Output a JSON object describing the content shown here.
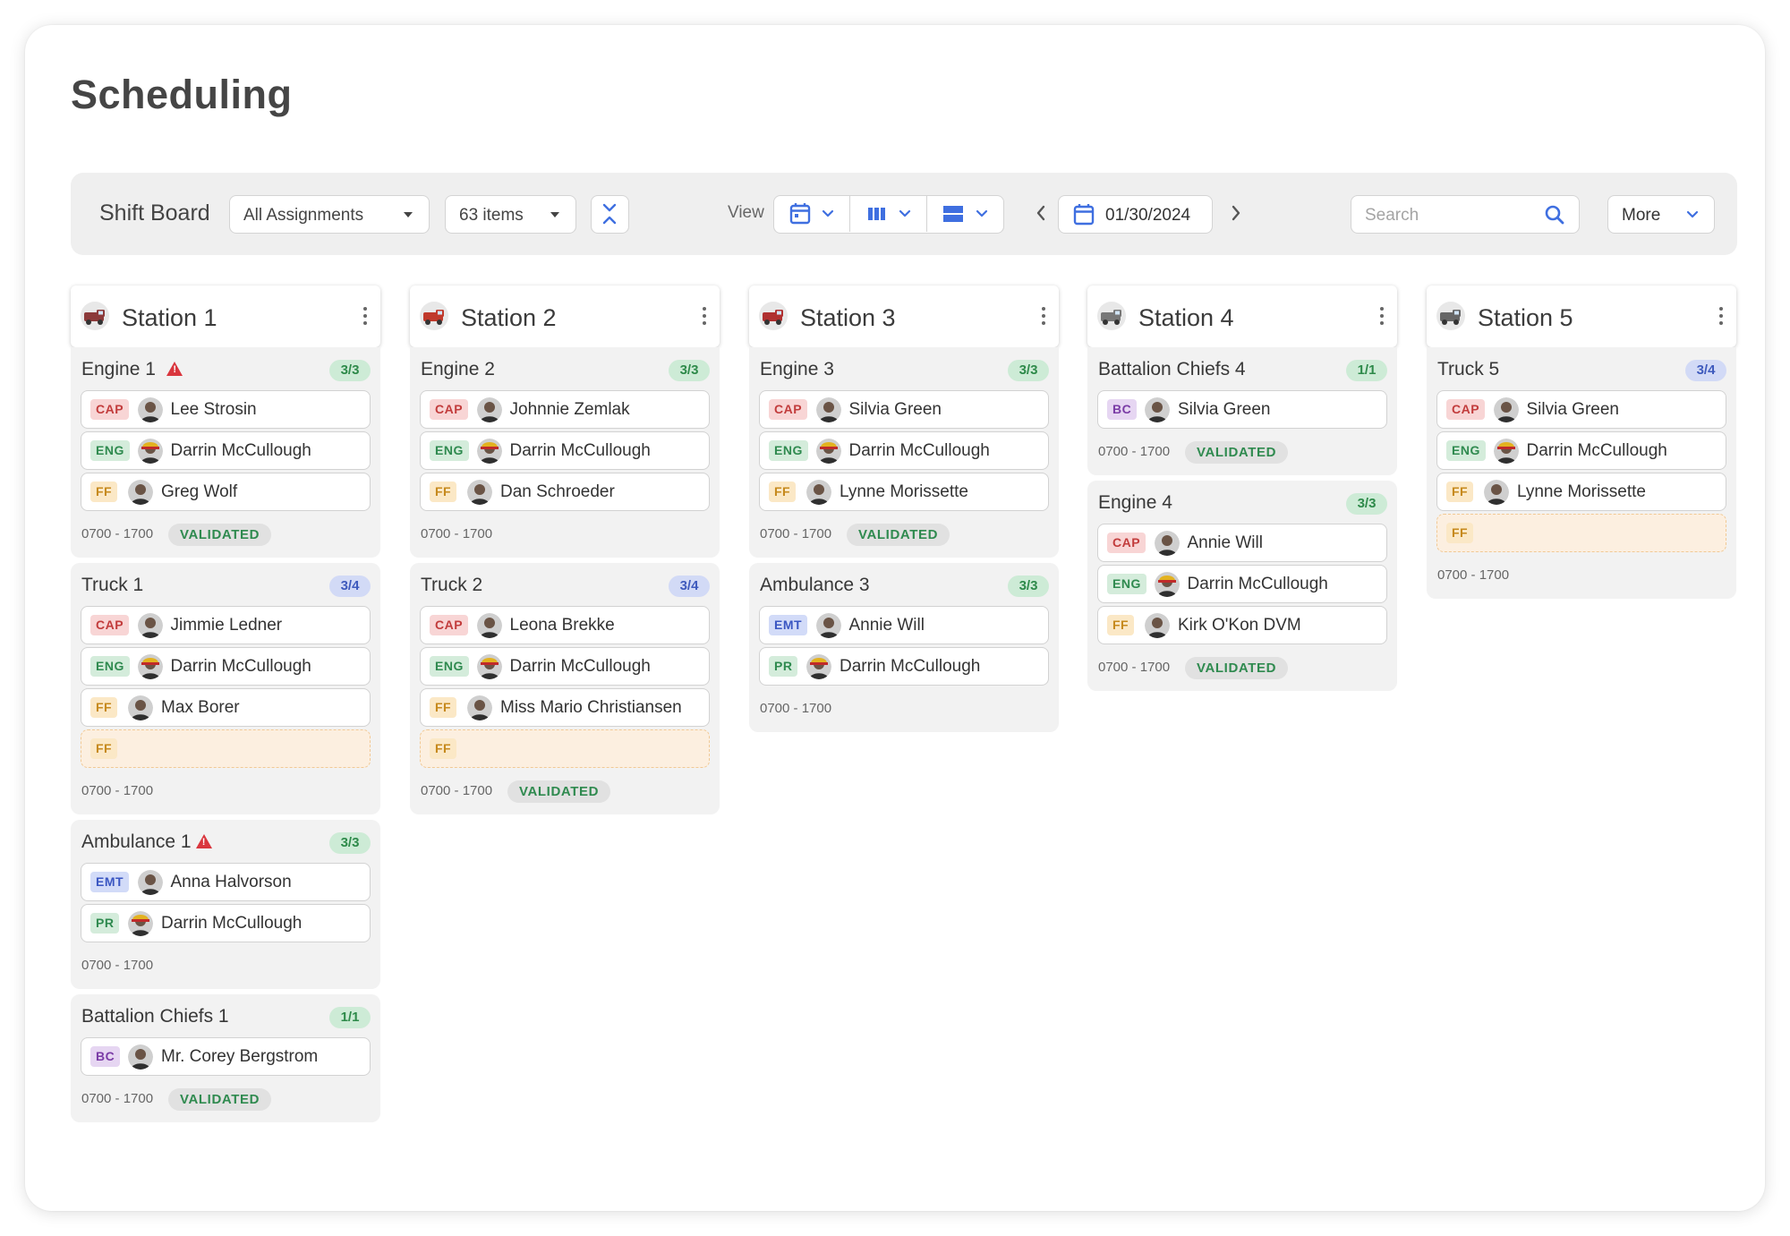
{
  "page_title": "Scheduling",
  "toolbar": {
    "title": "Shift Board",
    "assignments_value": "All Assignments",
    "items_value": "63 items",
    "view_label": "View",
    "date": "01/30/2024",
    "search_placeholder": "Search",
    "more_label": "More",
    "accent_color": "#3f6fe0"
  },
  "stations": [
    {
      "name": "Station 1",
      "units": [
        {
          "name": "Engine 1",
          "warning": true,
          "count": "3/3",
          "count_color": "green",
          "slots": [
            {
              "role": "CAP",
              "person": "Lee Strosin"
            },
            {
              "role": "ENG",
              "person": "Darrin McCullough"
            },
            {
              "role": "FF",
              "person": "Greg Wolf"
            }
          ],
          "time": "0700 - 1700",
          "status": "VALIDATED"
        },
        {
          "name": "Truck 1",
          "warning": false,
          "count": "3/4",
          "count_color": "blue",
          "slots": [
            {
              "role": "CAP",
              "person": "Jimmie Ledner"
            },
            {
              "role": "ENG",
              "person": "Darrin McCullough"
            },
            {
              "role": "FF",
              "person": "Max Borer"
            },
            {
              "role": "FF",
              "person": ""
            }
          ],
          "time": "0700 - 1700",
          "status": ""
        },
        {
          "name": "Ambulance 1",
          "warning": true,
          "count": "3/3",
          "count_color": "green",
          "slots": [
            {
              "role": "EMT",
              "person": "Anna Halvorson"
            },
            {
              "role": "PR",
              "person": "Darrin McCullough"
            }
          ],
          "time": "0700 - 1700",
          "status": ""
        },
        {
          "name": "Battalion Chiefs 1",
          "warning": false,
          "count": "1/1",
          "count_color": "green",
          "slots": [
            {
              "role": "BC",
              "person": "Mr. Corey Bergstrom"
            }
          ],
          "time": "0700 - 1700",
          "status": "VALIDATED"
        }
      ]
    },
    {
      "name": "Station 2",
      "units": [
        {
          "name": "Engine 2",
          "warning": false,
          "count": "3/3",
          "count_color": "green",
          "slots": [
            {
              "role": "CAP",
              "person": "Johnnie Zemlak"
            },
            {
              "role": "ENG",
              "person": "Darrin McCullough"
            },
            {
              "role": "FF",
              "person": "Dan Schroeder"
            }
          ],
          "time": "0700 - 1700",
          "status": ""
        },
        {
          "name": "Truck 2",
          "warning": false,
          "count": "3/4",
          "count_color": "blue",
          "slots": [
            {
              "role": "CAP",
              "person": "Leona Brekke"
            },
            {
              "role": "ENG",
              "person": "Darrin McCullough"
            },
            {
              "role": "FF",
              "person": "Miss Mario Christiansen"
            },
            {
              "role": "FF",
              "person": ""
            }
          ],
          "time": "0700 - 1700",
          "status": "VALIDATED"
        }
      ]
    },
    {
      "name": "Station 3",
      "units": [
        {
          "name": "Engine 3",
          "warning": false,
          "count": "3/3",
          "count_color": "green",
          "slots": [
            {
              "role": "CAP",
              "person": "Silvia Green"
            },
            {
              "role": "ENG",
              "person": "Darrin McCullough"
            },
            {
              "role": "FF",
              "person": "Lynne Morissette"
            }
          ],
          "time": "0700 - 1700",
          "status": "VALIDATED"
        },
        {
          "name": "Ambulance 3",
          "warning": false,
          "count": "3/3",
          "count_color": "green",
          "slots": [
            {
              "role": "EMT",
              "person": "Annie Will"
            },
            {
              "role": "PR",
              "person": "Darrin McCullough"
            }
          ],
          "time": "0700 - 1700",
          "status": ""
        }
      ]
    },
    {
      "name": "Station 4",
      "units": [
        {
          "name": "Battalion Chiefs 4",
          "warning": false,
          "count": "1/1",
          "count_color": "green",
          "slots": [
            {
              "role": "BC",
              "person": "Silvia Green"
            }
          ],
          "time": "0700 - 1700",
          "status": "VALIDATED"
        },
        {
          "name": "Engine 4",
          "warning": false,
          "count": "3/3",
          "count_color": "green",
          "slots": [
            {
              "role": "CAP",
              "person": "Annie Will"
            },
            {
              "role": "ENG",
              "person": "Darrin McCullough"
            },
            {
              "role": "FF",
              "person": "Kirk O'Kon DVM"
            }
          ],
          "time": "0700 - 1700",
          "status": "VALIDATED"
        }
      ]
    },
    {
      "name": "Station 5",
      "units": [
        {
          "name": "Truck 5",
          "warning": false,
          "count": "3/4",
          "count_color": "blue",
          "slots": [
            {
              "role": "CAP",
              "person": "Silvia Green"
            },
            {
              "role": "ENG",
              "person": "Darrin McCullough"
            },
            {
              "role": "FF",
              "person": "Lynne Morissette"
            },
            {
              "role": "FF",
              "person": ""
            }
          ],
          "time": "0700 - 1700",
          "status": ""
        }
      ]
    }
  ]
}
